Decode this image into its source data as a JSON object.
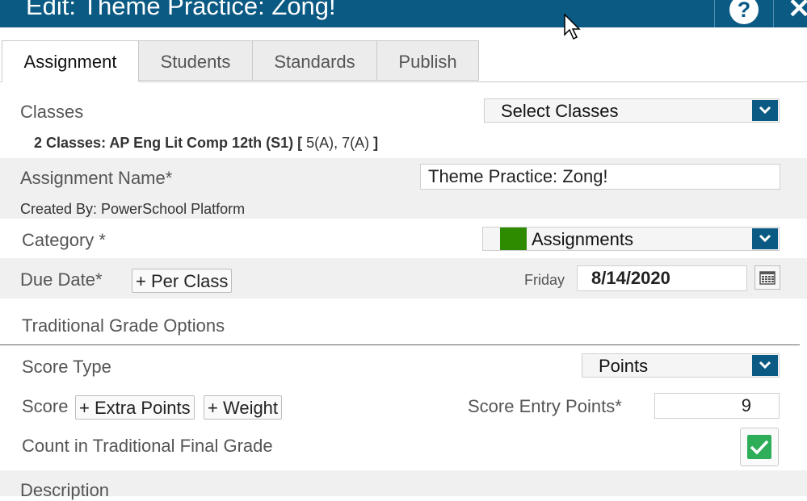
{
  "dialog": {
    "title": "Edit: Theme Practice: Zong!"
  },
  "tabs": [
    {
      "label": "Assignment"
    },
    {
      "label": "Students"
    },
    {
      "label": "Standards"
    },
    {
      "label": "Publish"
    }
  ],
  "classes": {
    "label": "Classes",
    "select_label": "Select Classes",
    "summary_bold": "2 Classes: AP Eng Lit Comp 12th (S1)",
    "summary_open": "[",
    "summary_sections": "5(A), 7(A)",
    "summary_close": "]"
  },
  "assignment_name": {
    "label": "Assignment Name*",
    "value": "Theme Practice: Zong!",
    "created_by": "Created By: PowerSchool Platform"
  },
  "category": {
    "label": "Category *",
    "value": "Assignments",
    "color": "#2e8b00"
  },
  "due_date": {
    "label": "Due Date*",
    "per_class_button": "+ Per Class",
    "day": "Friday",
    "date": "8/14/2020"
  },
  "grade_options": {
    "heading": "Traditional Grade Options",
    "score_type_label": "Score Type",
    "score_type_value": "Points",
    "score_label": "Score",
    "extra_points_button": "+ Extra Points",
    "weight_button": "+ Weight",
    "score_entry_label": "Score Entry Points*",
    "score_entry_value": "9",
    "count_final_label": "Count in Traditional Final Grade",
    "count_final_checked": true
  },
  "description": {
    "label": "Description"
  },
  "colors": {
    "header": "#0b5a84",
    "check": "#2fae5a",
    "band": "#f0f0f0"
  }
}
